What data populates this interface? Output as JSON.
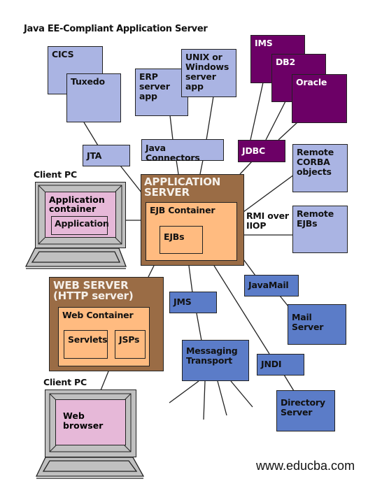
{
  "title": "Java EE-Compliant Application Server",
  "colors": {
    "legacy_system": "#aab4e3",
    "database": "#6c0066",
    "service": "#5b7cc8",
    "server": "#9a6c45",
    "container": "#ffbb80",
    "client_screen": "#e6b8d8",
    "client_frame": "#c0c0c0"
  },
  "legacy_systems": {
    "cics": "CICS",
    "tuxedo": "Tuxedo",
    "erp": "ERP server app",
    "unix": "UNIX or Windows server app"
  },
  "databases": {
    "ims": "IMS",
    "db2": "DB2",
    "oracle": "Oracle"
  },
  "apis": {
    "jta": "JTA",
    "java_connectors": "Java Connectors",
    "jdbc": "JDBC",
    "javamail": "JavaMail",
    "jms": "JMS",
    "jndi": "JNDI",
    "rmi_iiop": "RMI over IIOP"
  },
  "remote": {
    "corba": "Remote CORBA objects",
    "ejbs": "Remote EJBs"
  },
  "app_server": {
    "title": "APPLICATION SERVER",
    "container": "EJB Container",
    "component": "EJBs"
  },
  "web_server": {
    "title": "WEB SERVER (HTTP server)",
    "container": "Web Container",
    "servlets": "Servlets",
    "jsps": "JSPs"
  },
  "client_pc_1": {
    "label": "Client PC",
    "container": "Application container",
    "component": "Application"
  },
  "client_pc_2": {
    "label": "Client PC",
    "component": "Web browser"
  },
  "external": {
    "mail_server": "Mail Server",
    "messaging": "Messaging Transport",
    "directory": "Directory Server"
  },
  "watermark": "www.educba.com"
}
